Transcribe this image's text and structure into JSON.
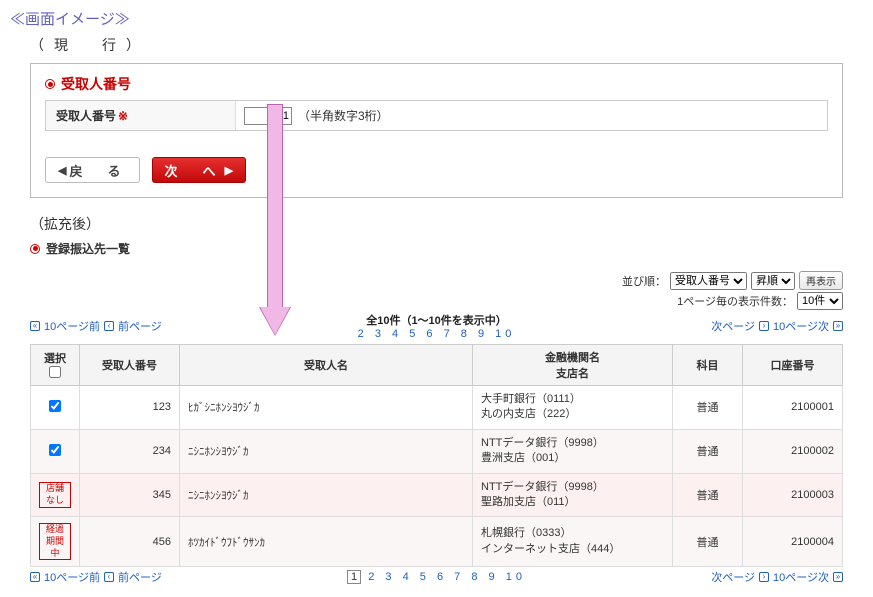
{
  "page_title": "≪画面イメージ≫",
  "subtitle_current": "（現　行）",
  "subtitle_after": "（拡充後）",
  "panel": {
    "section_label": "受取人番号",
    "field_label": "受取人番号",
    "required_mark": "※",
    "input_value": "001",
    "hint": "（半角数字3桁）",
    "back_label": "戻　る",
    "next_label": "次　へ"
  },
  "list": {
    "heading": "登録振込先一覧",
    "sort_label": "並び順：",
    "sort_field_options": [
      "受取人番号"
    ],
    "sort_field_value": "受取人番号",
    "sort_order_options": [
      "昇順"
    ],
    "sort_order_value": "昇順",
    "perpage_label": "1ページ毎の表示件数：",
    "perpage_options": [
      "10件"
    ],
    "perpage_value": "10件",
    "reshow_label": "再表示",
    "count_text": "全10件（1～10件を表示中）",
    "page_prev10": "10ページ前",
    "page_prev": "前ページ",
    "page_next": "次ページ",
    "page_next10": "10ページ次",
    "pages": [
      "1",
      "2",
      "3",
      "4",
      "5",
      "6",
      "7",
      "8",
      "9",
      "10"
    ],
    "columns": {
      "select": "選択",
      "number": "受取人番号",
      "name": "受取人名",
      "bank": "金融機関名",
      "branch": "支店名",
      "type": "科目",
      "account": "口座番号"
    },
    "rows": [
      {
        "check": true,
        "badge": "",
        "number": "123",
        "name": "ﾋｶﾞｼﾆﾎﾝｼﾖｳｼﾞｶ",
        "bank": "大手町銀行（0111）",
        "branch": "丸の内支店（222）",
        "type": "普通",
        "account": "2100001"
      },
      {
        "check": true,
        "badge": "",
        "number": "234",
        "name": "ﾆｼﾆﾎﾝｼﾖｳｼﾞｶ",
        "bank": "NTTデータ銀行（9998）",
        "branch": "豊洲支店（001）",
        "type": "普通",
        "account": "2100002"
      },
      {
        "check": false,
        "badge": "店舗なし",
        "number": "345",
        "name": "ﾆｼﾆﾎﾝｼﾖｳｼﾞｶ",
        "bank": "NTTデータ銀行（9998）",
        "branch": "聖路加支店（011）",
        "type": "普通",
        "account": "2100003",
        "highlight": true
      },
      {
        "check": false,
        "badge": "経過\n期間中",
        "number": "456",
        "name": "ﾎﾂｶｲﾄﾞｳﾌﾄﾞｳｻﾝｶ",
        "bank": "札幌銀行（0333）",
        "branch": "インターネット支店（444）",
        "type": "普通",
        "account": "2100004"
      }
    ]
  }
}
